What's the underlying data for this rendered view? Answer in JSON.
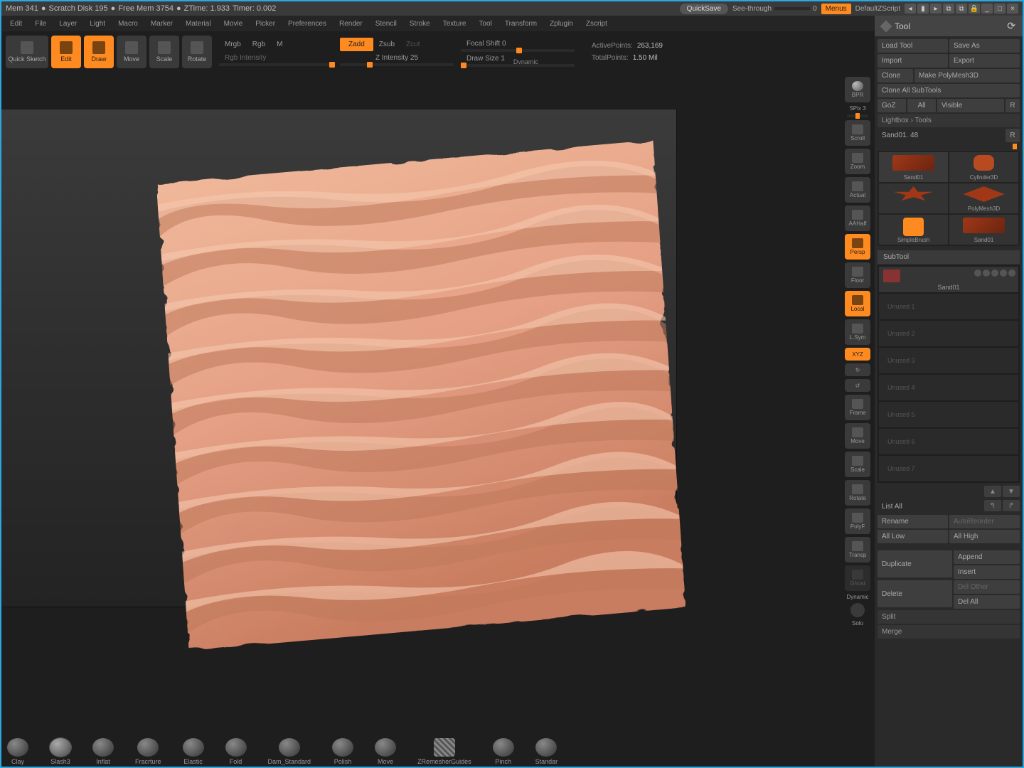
{
  "status": {
    "mem": "Mem 341",
    "scratch": "Scratch Disk 195",
    "free": "Free Mem 3754",
    "ztime": "ZTime: 1.933",
    "timer": "Timer: 0.002",
    "quicksave": "QuickSave",
    "seethru": "See-through",
    "seethru_val": "0",
    "menus": "Menus",
    "dzscript": "DefaultZScript"
  },
  "menus": [
    "Edit",
    "File",
    "Layer",
    "Light",
    "Macro",
    "Marker",
    "Material",
    "Movie",
    "Picker",
    "Preferences",
    "Render",
    "Stencil",
    "Stroke",
    "Texture",
    "Tool",
    "Transform",
    "Zplugin",
    "Zscript"
  ],
  "toolbar": {
    "quick_sketch": "Quick Sketch",
    "edit": "Edit",
    "draw": "Draw",
    "move": "Move",
    "scale": "Scale",
    "rotate": "Rotate",
    "mrgb": "Mrgb",
    "rgb": "Rgb",
    "m": "M",
    "rgb_int": "Rgb Intensity",
    "zadd": "Zadd",
    "zsub": "Zsub",
    "zcut": "Zcut",
    "zint": "Z Intensity 25",
    "focal": "Focal Shift 0",
    "draw_size": "Draw Size 1",
    "dynamic": "Dynamic",
    "active_pts_label": "ActivePoints:",
    "active_pts": "263,169",
    "total_pts_label": "TotalPoints:",
    "total_pts": "1.50 Mil"
  },
  "vtool": {
    "bpr": "BPR",
    "spix": "SPix 3",
    "scroll": "Scroll",
    "zoom": "Zoom",
    "actual": "Actual",
    "aahalf": "AAHalf",
    "persp": "Persp",
    "floor": "Floor",
    "local": "Local",
    "lsym": "L.Sym",
    "xyz": "XYZ",
    "frame": "Frame",
    "move": "Move",
    "scale": "Scale",
    "rotate": "Rotate",
    "polyf": "PolyF",
    "transp": "Transp",
    "ghost": "Ghost",
    "dynamic": "Dynamic",
    "solo": "Solo"
  },
  "panel": {
    "title": "Tool",
    "load": "Load Tool",
    "save_as": "Save As",
    "import": "Import",
    "export": "Export",
    "clone": "Clone",
    "make_pm3d": "Make PolyMesh3D",
    "clone_all": "Clone All SubTools",
    "goz": "GoZ",
    "all": "All",
    "visible": "Visible",
    "r": "R",
    "lightbox": "Lightbox › Tools",
    "current": "Sand01. 48",
    "tools": [
      "Sand01",
      "Cylinder3D",
      "",
      "PolyMesh3D",
      "SimpleBrush",
      "Sand01"
    ],
    "subtool": "SubTool",
    "st_active": "Sand01",
    "unused": [
      "Unused 1",
      "Unused 2",
      "Unused 3",
      "Unused 4",
      "Unused 5",
      "Unused 6",
      "Unused 7"
    ],
    "list_all": "List All",
    "rename": "Rename",
    "autoreorder": "AutoReorder",
    "all_low": "All Low",
    "all_high": "All High",
    "duplicate": "Duplicate",
    "append": "Append",
    "insert": "Insert",
    "delete": "Delete",
    "del_other": "Del Other",
    "del_all": "Del All",
    "split": "Split",
    "merge": "Merge"
  },
  "brushes": [
    "Clay",
    "Slash3",
    "Inflat",
    "Fracrture",
    "Elastic",
    "Fold",
    "Dam_Standard",
    "Polish",
    "Move",
    "ZRemesherGuides",
    "Pinch",
    "Standar"
  ]
}
